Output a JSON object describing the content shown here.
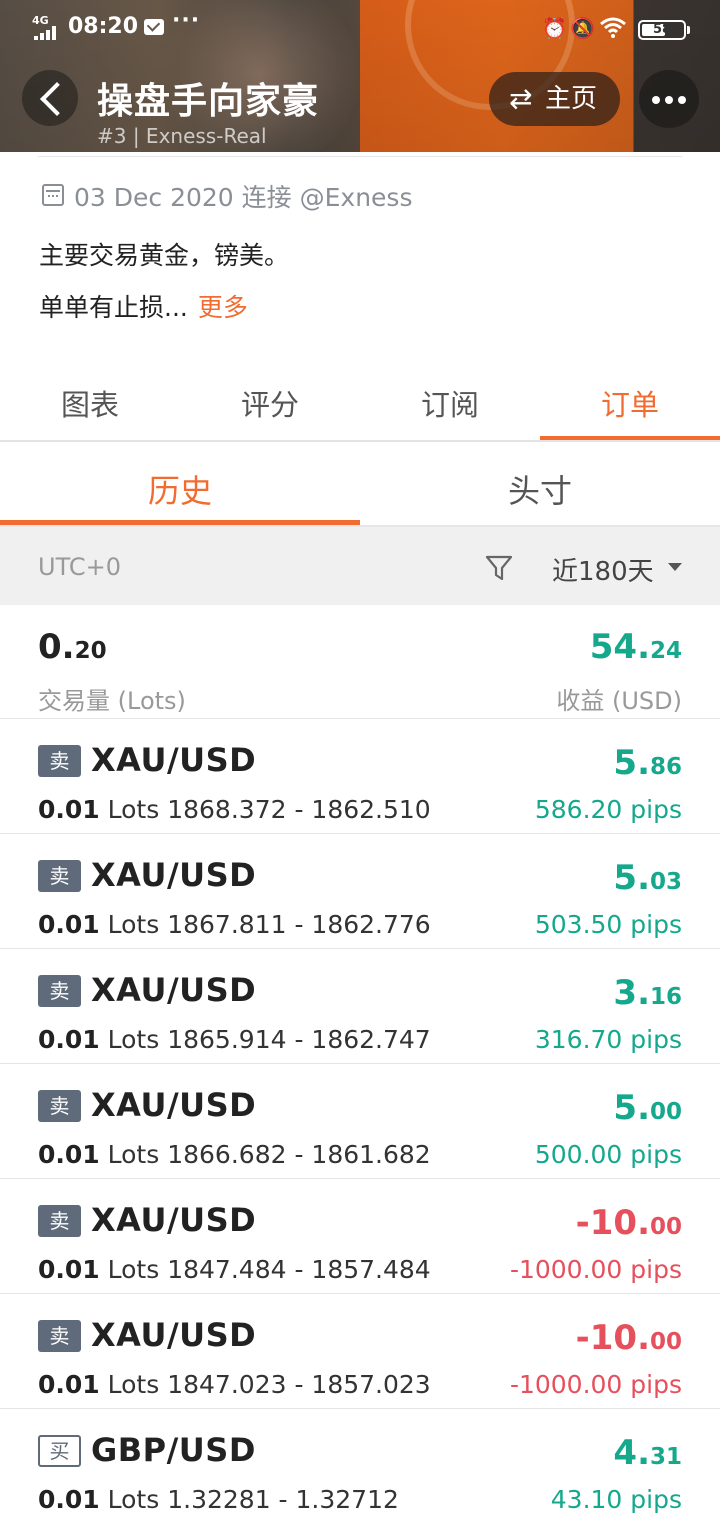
{
  "status_bar": {
    "network": "4G",
    "time": "08:20",
    "battery": "58"
  },
  "header": {
    "title": "操盘手向家豪",
    "subtitle": "#3 | Exness-Real",
    "home_label": "主页"
  },
  "profile": {
    "connected": "03 Dec 2020 连接 @Exness",
    "description_line1": "主要交易黄金，镑美。",
    "description_line2": "单单有止损...",
    "more_label": "更多"
  },
  "tabs": [
    "图表",
    "评分",
    "订阅",
    "订单"
  ],
  "active_tab": "订单",
  "subtabs": [
    "历史",
    "头寸"
  ],
  "active_subtab": "历史",
  "filter": {
    "timezone": "UTC+0",
    "period": "近180天"
  },
  "summary": {
    "volume_int": "0.",
    "volume_dec": "20",
    "volume_label": "交易量 (Lots)",
    "profit_int": "54.",
    "profit_dec": "24",
    "profit_label": "收益 (USD)"
  },
  "orders": [
    {
      "side": "卖",
      "symbol": "XAU/USD",
      "lots": "0.01",
      "lots_unit": "Lots",
      "prices": "1868.372 - 1862.510",
      "profit_int": "5.",
      "profit_dec": "86",
      "pips": "586.20 pips",
      "positive": true
    },
    {
      "side": "卖",
      "symbol": "XAU/USD",
      "lots": "0.01",
      "lots_unit": "Lots",
      "prices": "1867.811 - 1862.776",
      "profit_int": "5.",
      "profit_dec": "03",
      "pips": "503.50 pips",
      "positive": true
    },
    {
      "side": "卖",
      "symbol": "XAU/USD",
      "lots": "0.01",
      "lots_unit": "Lots",
      "prices": "1865.914 - 1862.747",
      "profit_int": "3.",
      "profit_dec": "16",
      "pips": "316.70 pips",
      "positive": true
    },
    {
      "side": "卖",
      "symbol": "XAU/USD",
      "lots": "0.01",
      "lots_unit": "Lots",
      "prices": "1866.682 - 1861.682",
      "profit_int": "5.",
      "profit_dec": "00",
      "pips": "500.00 pips",
      "positive": true
    },
    {
      "side": "卖",
      "symbol": "XAU/USD",
      "lots": "0.01",
      "lots_unit": "Lots",
      "prices": "1847.484 - 1857.484",
      "profit_int": "-10.",
      "profit_dec": "00",
      "pips": "-1000.00 pips",
      "positive": false
    },
    {
      "side": "卖",
      "symbol": "XAU/USD",
      "lots": "0.01",
      "lots_unit": "Lots",
      "prices": "1847.023 - 1857.023",
      "profit_int": "-10.",
      "profit_dec": "00",
      "pips": "-1000.00 pips",
      "positive": false
    },
    {
      "side": "买",
      "symbol": "GBP/USD",
      "lots": "0.01",
      "lots_unit": "Lots",
      "prices": "1.32281 - 1.32712",
      "profit_int": "4.",
      "profit_dec": "31",
      "pips": "43.10 pips",
      "positive": true
    }
  ],
  "colors": {
    "accent": "#f26b30",
    "positive": "#15a88c",
    "negative": "#e5505c",
    "badge": "#5f6b7a"
  },
  "icons": {
    "back": "chevron-left-icon",
    "swap": "swap-arrows-icon",
    "more": "more-dots-icon",
    "calendar": "calendar-icon",
    "filter": "funnel-icon",
    "dropdown": "caret-down-icon"
  }
}
